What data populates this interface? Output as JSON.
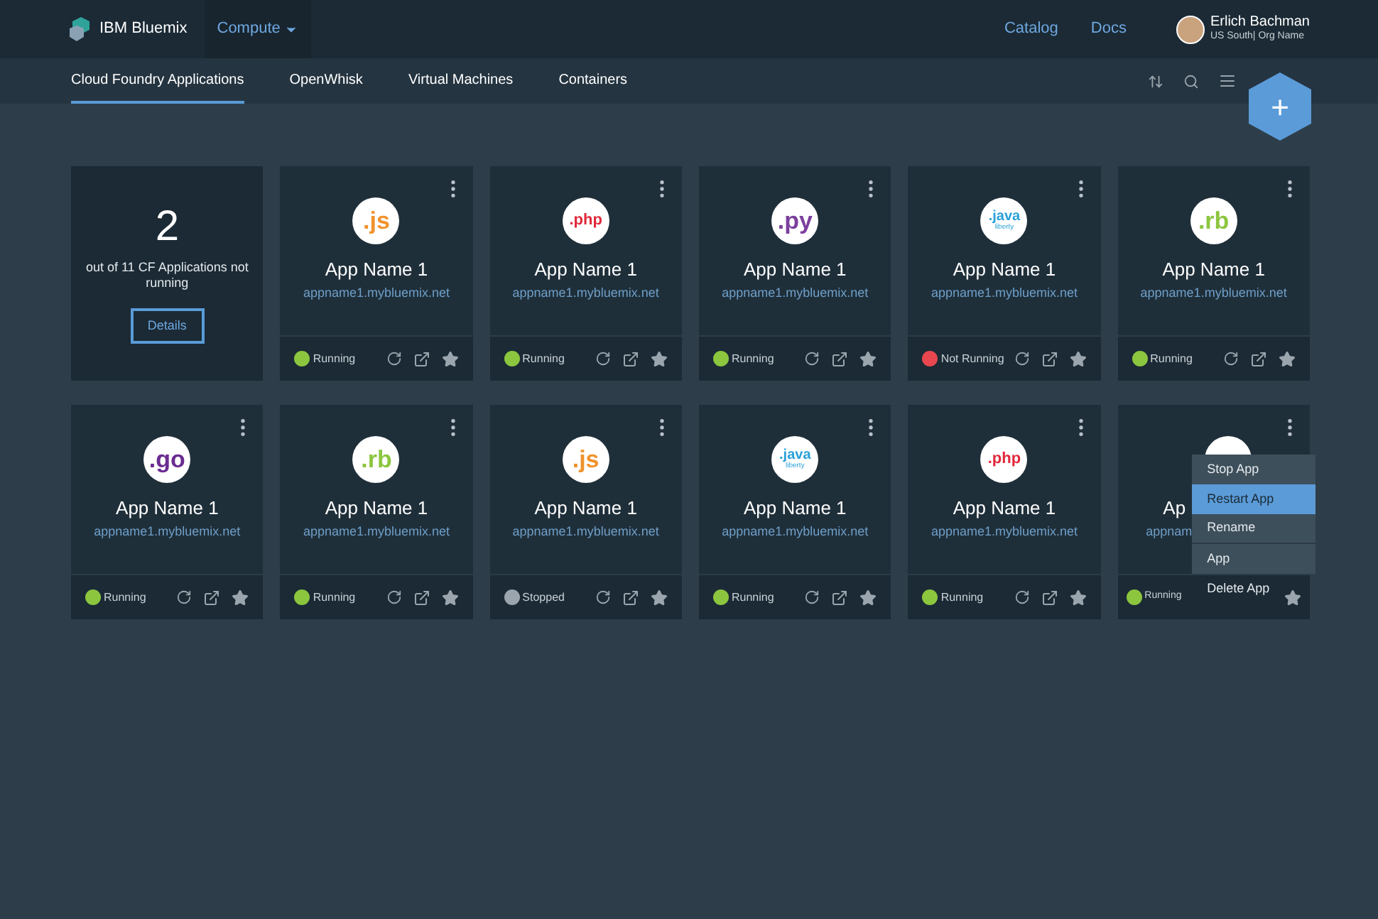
{
  "header": {
    "brand": "IBM Bluemix",
    "menu": {
      "label": "Compute"
    },
    "links": [
      "Catalog",
      "Docs"
    ],
    "user": {
      "name": "Erlich Bachman",
      "org": "US South| Org Name"
    }
  },
  "tabs": [
    {
      "label": "Cloud Foundry Applications",
      "selected": true
    },
    {
      "label": "OpenWhisk",
      "selected": false
    },
    {
      "label": "Virtual Machines",
      "selected": false
    },
    {
      "label": "Containers",
      "selected": false
    }
  ],
  "add_button": {
    "label": "+"
  },
  "summary": {
    "count": "2",
    "text": "out of 11 CF Applications not running",
    "button": "Details"
  },
  "apps": [
    {
      "logo": {
        "kind": "js",
        "text": ".js"
      },
      "name": "App Name 1",
      "url": "appname1.mybluemix.net",
      "status": {
        "kind": "running",
        "label": "Running"
      }
    },
    {
      "logo": {
        "kind": "php",
        "text": ".php"
      },
      "name": "App Name 1",
      "url": "appname1.mybluemix.net",
      "status": {
        "kind": "running",
        "label": "Running"
      }
    },
    {
      "logo": {
        "kind": "py",
        "text": ".py"
      },
      "name": "App Name 1",
      "url": "appname1.mybluemix.net",
      "status": {
        "kind": "running",
        "label": "Running"
      }
    },
    {
      "logo": {
        "kind": "java",
        "text": ".java",
        "sub": "liberty"
      },
      "name": "App Name 1",
      "url": "appname1.mybluemix.net",
      "status": {
        "kind": "not_running",
        "label": "Not Running"
      }
    },
    {
      "logo": {
        "kind": "rb",
        "text": ".rb"
      },
      "name": "App Name 1",
      "url": "appname1.mybluemix.net",
      "status": {
        "kind": "running",
        "label": "Running"
      }
    },
    {
      "logo": {
        "kind": "go",
        "text": ".go"
      },
      "name": "App Name 1",
      "url": "appname1.mybluemix.net",
      "status": {
        "kind": "running",
        "label": "Running"
      }
    },
    {
      "logo": {
        "kind": "rb",
        "text": ".rb"
      },
      "name": "App Name 1",
      "url": "appname1.mybluemix.net",
      "status": {
        "kind": "running",
        "label": "Running"
      }
    },
    {
      "logo": {
        "kind": "js",
        "text": ".js"
      },
      "name": "App Name 1",
      "url": "appname1.mybluemix.net",
      "status": {
        "kind": "stopped",
        "label": "Stopped"
      }
    },
    {
      "logo": {
        "kind": "java",
        "text": ".java",
        "sub": "liberty"
      },
      "name": "App Name 1",
      "url": "appname1.mybluemix.net",
      "status": {
        "kind": "running",
        "label": "Running"
      }
    },
    {
      "logo": {
        "kind": "php",
        "text": ".php"
      },
      "name": "App Name 1",
      "url": "appname1.mybluemix.net",
      "status": {
        "kind": "running",
        "label": "Running"
      }
    },
    {
      "name": "Ap",
      "url": "appnam",
      "status": {
        "kind": "running",
        "label": "Running"
      },
      "menu": [
        {
          "label": "Stop App",
          "selected": false
        },
        {
          "label": "Restart App",
          "selected": true
        },
        {
          "label": "Rename",
          "selected": false
        },
        {
          "label": "App",
          "selected": false
        },
        {
          "label": "Delete App",
          "selected": false
        }
      ]
    }
  ]
}
